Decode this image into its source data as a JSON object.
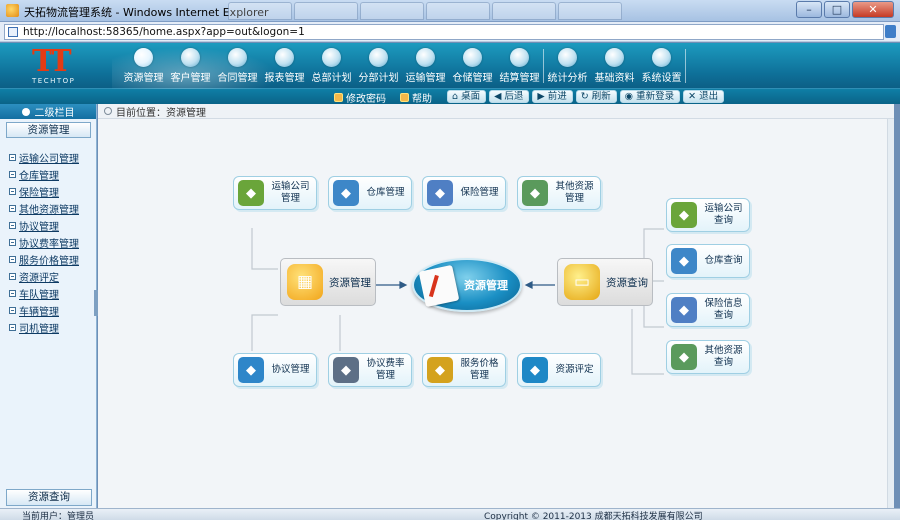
{
  "window": {
    "title": "天拓物流管理系统 - Windows Internet Explorer",
    "url": "http://localhost:58365/home.aspx?app=out&logon=1"
  },
  "header": {
    "logo_mark": "TT",
    "logo_word": "TECHTOP",
    "nav": [
      {
        "label": "资源管理",
        "icon": "gear-icon"
      },
      {
        "label": "客户管理",
        "icon": "user-icon"
      },
      {
        "label": "合同管理",
        "icon": "contract-icon"
      },
      {
        "label": "报表管理",
        "icon": "document-icon"
      },
      {
        "label": "总部计划",
        "icon": "plan-icon"
      },
      {
        "label": "分部计划",
        "icon": "branch-plan-icon"
      },
      {
        "label": "运输管理",
        "icon": "truck-icon"
      },
      {
        "label": "仓储管理",
        "icon": "warehouse-icon"
      },
      {
        "label": "结算管理",
        "icon": "dollar-icon"
      },
      {
        "label": "统计分析",
        "icon": "chart-icon"
      },
      {
        "label": "基础资料",
        "icon": "folder-icon"
      },
      {
        "label": "系统设置",
        "icon": "settings-icon"
      }
    ]
  },
  "toolbar": {
    "change_password": "修改密码",
    "help": "帮助",
    "buttons": [
      "桌面",
      "后退",
      "前进",
      "刷新",
      "重新登录",
      "退出"
    ]
  },
  "sidebar": {
    "heading": "二级栏目",
    "section_button": "资源管理",
    "items": [
      "运输公司管理",
      "仓库管理",
      "保险管理",
      "其他资源管理",
      "协议管理",
      "协议费率管理",
      "服务价格管理",
      "资源评定",
      "车队管理",
      "车辆管理",
      "司机管理"
    ],
    "bottom_button": "资源查询"
  },
  "main": {
    "breadcrumb": "目前位置：资源管理",
    "core_label": "资源管理",
    "hub_left": "资源管理",
    "hub_right": "资源查询",
    "top_nodes": [
      {
        "text": "运输公司\n管理",
        "color": "#6aa53a"
      },
      {
        "text": "仓库管理",
        "color": "#3d87c8"
      },
      {
        "text": "保险管理",
        "color": "#4f7fc4"
      },
      {
        "text": "其他资源\n管理",
        "color": "#5a9a5c"
      }
    ],
    "bottom_nodes": [
      {
        "text": "协议管理",
        "color": "#2e86c9"
      },
      {
        "text": "协议费率\n管理",
        "color": "#5d6f86"
      },
      {
        "text": "服务价格\n管理",
        "color": "#d4a21e"
      },
      {
        "text": "资源评定",
        "color": "#1e88c6"
      }
    ],
    "right_nodes": [
      {
        "text": "运输公司\n查询",
        "color": "#6aa53a"
      },
      {
        "text": "仓库查询",
        "color": "#3d87c8"
      },
      {
        "text": "保险信息\n查询",
        "color": "#4f7fc4"
      },
      {
        "text": "其他资源\n查询",
        "color": "#5a9a5c"
      }
    ]
  },
  "statusbar": {
    "left": "当前用户：管理员",
    "right": "Copyright © 2011-2013 成都天拓科技发展有限公司"
  }
}
